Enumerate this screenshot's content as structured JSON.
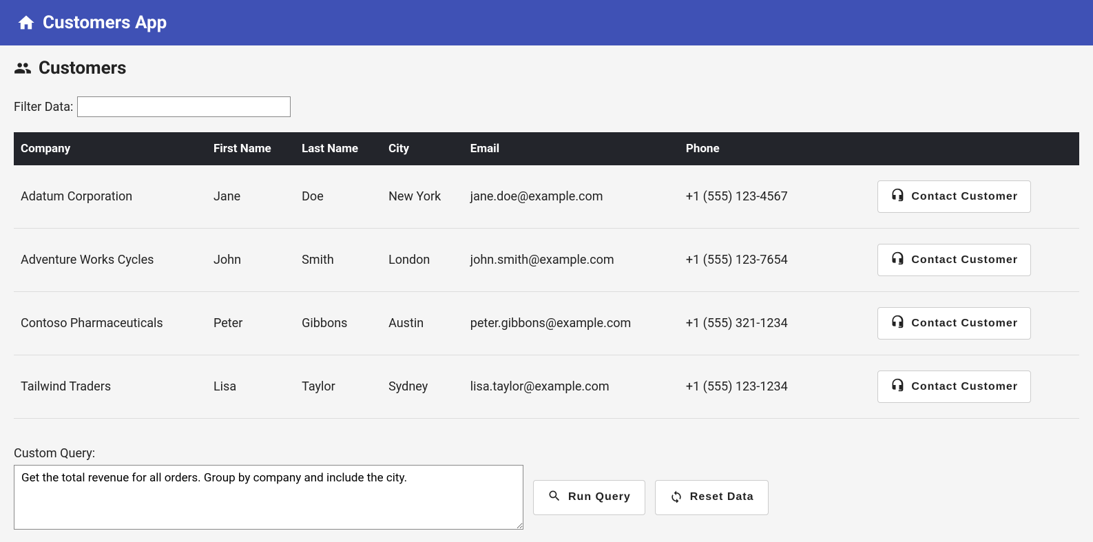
{
  "header": {
    "title": "Customers App"
  },
  "page": {
    "heading": "Customers",
    "filter_label": "Filter Data:",
    "filter_value": "",
    "query_label": "Custom Query:",
    "query_value": "Get the total revenue for all orders. Group by company and include the city.",
    "run_query_label": "Run Query",
    "reset_data_label": "Reset Data",
    "contact_label": "Contact Customer"
  },
  "table": {
    "columns": [
      "Company",
      "First Name",
      "Last Name",
      "City",
      "Email",
      "Phone"
    ],
    "rows": [
      {
        "company": "Adatum Corporation",
        "first": "Jane",
        "last": "Doe",
        "city": "New York",
        "email": "jane.doe@example.com",
        "phone": "+1 (555) 123-4567"
      },
      {
        "company": "Adventure Works Cycles",
        "first": "John",
        "last": "Smith",
        "city": "London",
        "email": "john.smith@example.com",
        "phone": "+1 (555) 123-7654"
      },
      {
        "company": "Contoso Pharmaceuticals",
        "first": "Peter",
        "last": "Gibbons",
        "city": "Austin",
        "email": "peter.gibbons@example.com",
        "phone": "+1 (555) 321-1234"
      },
      {
        "company": "Tailwind Traders",
        "first": "Lisa",
        "last": "Taylor",
        "city": "Sydney",
        "email": "lisa.taylor@example.com",
        "phone": "+1 (555) 123-1234"
      }
    ]
  }
}
